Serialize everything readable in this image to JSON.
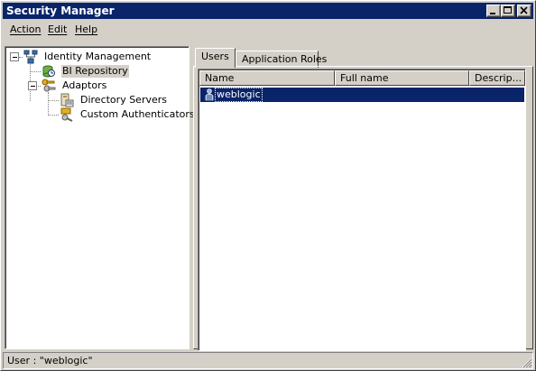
{
  "window": {
    "title": "Security Manager",
    "controls": {
      "minimize_icon": "minimize-icon",
      "maximize_icon": "maximize-icon",
      "close_icon": "close-icon"
    }
  },
  "menu": {
    "action": "Action",
    "edit": "Edit",
    "help": "Help"
  },
  "tree": {
    "root": {
      "label": "Identity Management",
      "icon": "network-icon"
    },
    "bi_repository": {
      "label": "BI Repository",
      "icon": "repository-icon"
    },
    "adaptors": {
      "label": "Adaptors",
      "icon": "keys-icon"
    },
    "directory_servers": {
      "label": "Directory Servers",
      "icon": "directory-icon"
    },
    "custom_authenticators": {
      "label": "Custom Authenticators",
      "icon": "key-icon"
    }
  },
  "tabs": [
    {
      "label": "Users",
      "active": true
    },
    {
      "label": "Application Roles",
      "active": false
    }
  ],
  "table": {
    "columns": [
      "Name",
      "Full name",
      "Descrip..."
    ],
    "rows": [
      {
        "name": "weblogic",
        "full_name": "",
        "description": "",
        "icon": "user-icon",
        "selected": true
      }
    ]
  },
  "status": {
    "text": "User : \"weblogic\""
  },
  "colors": {
    "titlebar": "#0a246a",
    "selection": "#0a246a",
    "face": "#d4d0c8"
  }
}
